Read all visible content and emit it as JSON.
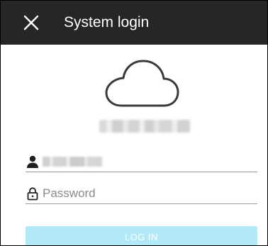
{
  "header": {
    "title": "System login",
    "close_icon": "close-icon",
    "background_color": "#262626"
  },
  "cloud_logo": {
    "icon": "cloud-icon"
  },
  "server": {
    "label": "xxxxxxxxxxxxxx"
  },
  "form": {
    "username": {
      "icon": "person-icon",
      "value": "xxxxxxxx"
    },
    "password": {
      "icon": "lock-icon",
      "placeholder": "Password",
      "value": ""
    },
    "login_button": {
      "label": "LOG IN",
      "color": "#b3e8f7"
    }
  }
}
